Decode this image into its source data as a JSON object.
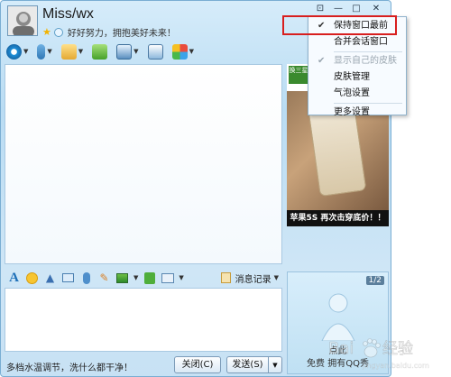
{
  "contact": {
    "name": "Miss/wx",
    "signature": "好好努力，拥抱美好未来！"
  },
  "window_controls": [
    "⊡",
    "—",
    "□",
    "✕"
  ],
  "chat_input": {
    "placeholder_tip": "多档水温调节，洗什么都干净！"
  },
  "format_toolbar": {
    "history_label": "消息记录"
  },
  "buttons": {
    "close": "关闭(C)",
    "send": "发送(S)"
  },
  "ad": {
    "tag": "换三星",
    "caption": "苹果5S 再次击穿底价！！"
  },
  "promo": {
    "page": "1/2",
    "line1": "点此",
    "line2": "免费 拥有QQ秀"
  },
  "context_menu": {
    "items": [
      {
        "label": "保持窗口最前",
        "checked": true,
        "disabled": false
      },
      {
        "label": "合并会话窗口",
        "checked": false,
        "disabled": false
      },
      {
        "label": "显示自己的皮肤",
        "checked": true,
        "disabled": true
      },
      {
        "label": "皮肤管理",
        "checked": false,
        "disabled": false
      },
      {
        "label": "气泡设置",
        "checked": false,
        "disabled": false
      },
      {
        "label": "更多设置",
        "checked": false,
        "disabled": false
      }
    ]
  },
  "watermark": {
    "text": "Bai 经验",
    "subtext": "jingyan.baidu.com"
  },
  "colors": {
    "highlight": "#d81e1e",
    "window_bg": "#c7e1f4"
  }
}
